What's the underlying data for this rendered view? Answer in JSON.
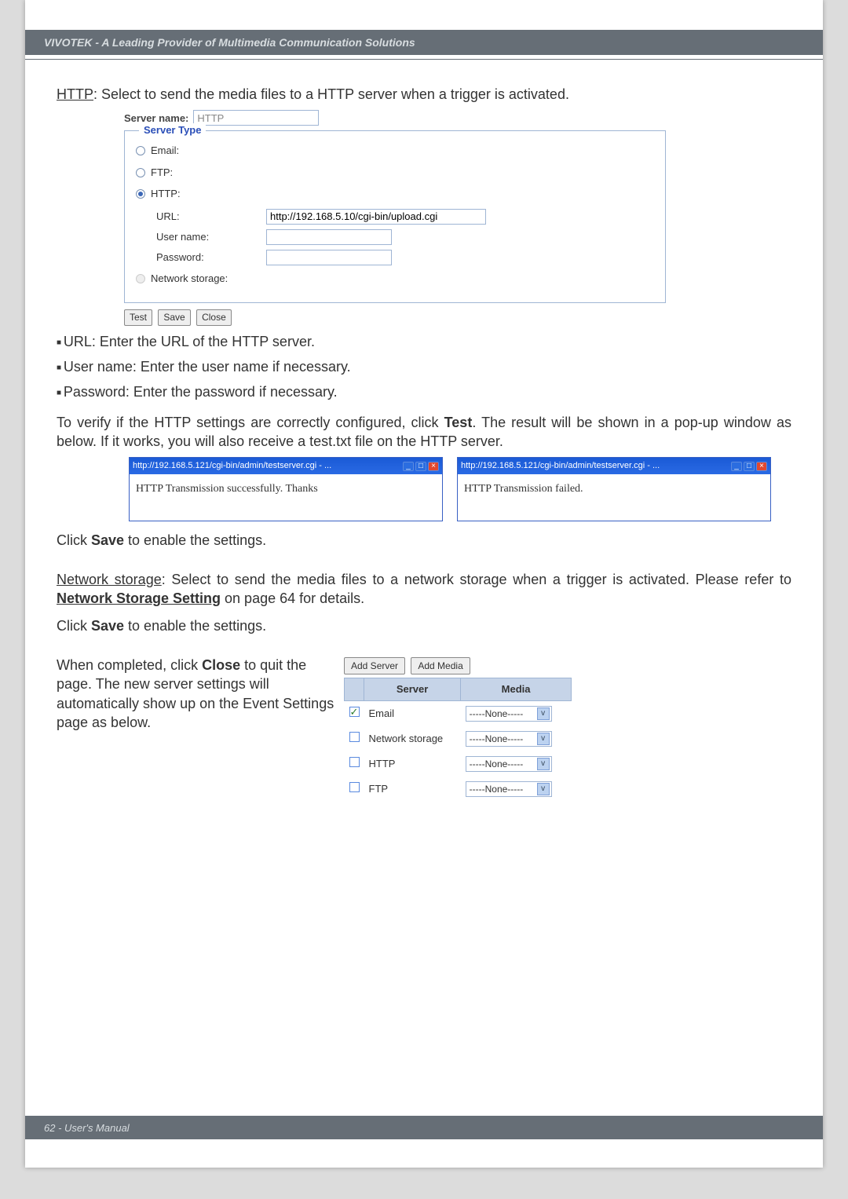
{
  "header": {
    "text": "VIVOTEK - A Leading Provider of Multimedia Communication Solutions"
  },
  "intro": {
    "http_label": "HTTP",
    "http_text": ": Select to send the media files to a HTTP server when a trigger is activated."
  },
  "form": {
    "server_name_label": "Server name:",
    "server_name_value": "HTTP",
    "legend": "Server Type",
    "opt_email": "Email:",
    "opt_ftp": "FTP:",
    "opt_http": "HTTP:",
    "opt_ns": "Network storage:",
    "url_label": "URL:",
    "url_value": "http://192.168.5.10/cgi-bin/upload.cgi",
    "user_label": "User name:",
    "pass_label": "Password:",
    "btn_test": "Test",
    "btn_save": "Save",
    "btn_close": "Close"
  },
  "bullets": {
    "b1": "URL: Enter the URL of the HTTP server.",
    "b2": "User name: Enter the user name if necessary.",
    "b3": "Password: Enter the password if necessary."
  },
  "verify": {
    "pre": "To verify if the HTTP settings are correctly configured, click ",
    "test": "Test",
    "post": ". The result will be shown in a pop-up window as below. If it works, you will also receive a test.txt file on the HTTP server."
  },
  "popup": {
    "title": "http://192.168.5.121/cgi-bin/admin/testserver.cgi - ...",
    "success": "HTTP Transmission successfully. Thanks",
    "fail": "HTTP Transmission failed."
  },
  "after_popups_pre": "Click ",
  "after_popups_bold": "Save",
  "after_popups_post": " to enable the settings.",
  "ns": {
    "heading": "Network storage",
    "sentence_mid": ": Select to send the media files to a network storage when a trigger is activated. Please refer to ",
    "link": "Network Storage Setting",
    "sentence_end": " on page 64 for details."
  },
  "save_again_pre": "Click ",
  "save_again_bold": "Save",
  "save_again_post": " to enable the settings.",
  "completed_pre": "When completed, click ",
  "completed_bold": "Close",
  "completed_post": " to quit the page. The new server settings will automatically show up on the Event Settings page as below.",
  "evt": {
    "add_server": "Add Server",
    "add_media": "Add Media",
    "col_server": "Server",
    "col_media": "Media",
    "none": "-----None-----",
    "rows": [
      {
        "name": "Email",
        "checked": true
      },
      {
        "name": "Network storage",
        "checked": false
      },
      {
        "name": "HTTP",
        "checked": false
      },
      {
        "name": "FTP",
        "checked": false
      }
    ]
  },
  "footer": {
    "text": "62 - User's Manual"
  }
}
